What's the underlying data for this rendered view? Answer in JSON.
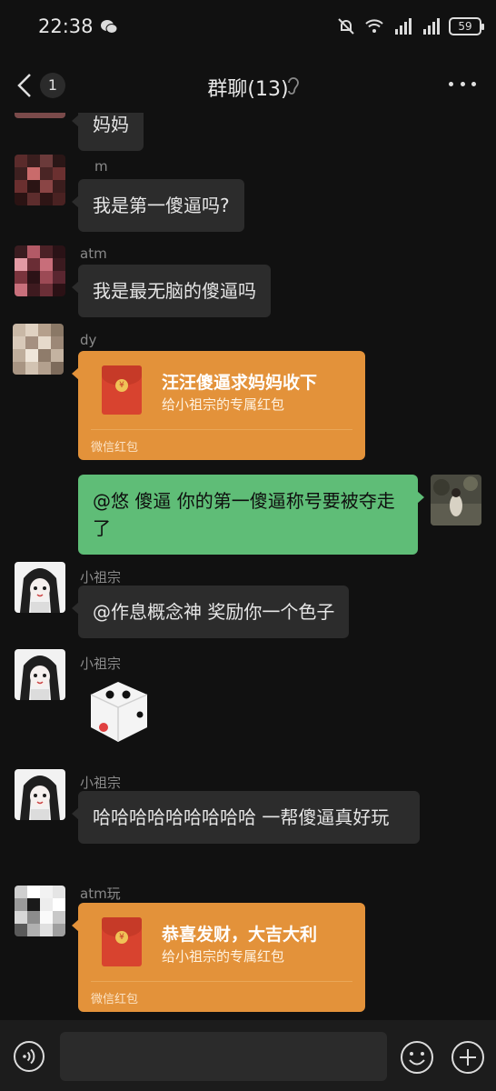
{
  "status_bar": {
    "time": "22:38",
    "battery": "59"
  },
  "header": {
    "unread_count": "1",
    "title": "群聊(13)"
  },
  "messages": [
    {
      "text": "妈妈"
    },
    {
      "sender": "m",
      "text": "我是第一傻逼吗?"
    },
    {
      "sender": "atm",
      "text": "我是最无脑的傻逼吗"
    },
    {
      "sender": "dy",
      "packet_title": "汪汪傻逼求妈妈收下",
      "packet_sub": "给小祖宗的专属红包",
      "packet_label": "微信红包"
    },
    {
      "text": "@悠  傻逼 你的第一傻逼称号要被夺走了"
    },
    {
      "sender": "小祖宗",
      "text": "@作息概念神  奖励你一个色子"
    },
    {
      "sender": "小祖宗"
    },
    {
      "sender": "小祖宗",
      "text": "哈哈哈哈哈哈哈哈哈 一帮傻逼真好玩"
    },
    {
      "sender": "atm玩",
      "packet_title": "恭喜发财，大吉大利",
      "packet_sub": "给小祖宗的专属红包",
      "packet_label": "微信红包"
    }
  ],
  "colors": {
    "background": "#111111",
    "bubble_other": "#2c2c2c",
    "bubble_mine": "#5fbd77",
    "red_packet": "#e3923a"
  },
  "icons": [
    "wechat-icon",
    "mute-bell-icon",
    "wifi-icon",
    "signal-icon",
    "battery-icon",
    "back-chevron-icon",
    "ear-icon",
    "more-icon",
    "voice-icon",
    "emoji-icon",
    "plus-icon",
    "dice-icon"
  ]
}
